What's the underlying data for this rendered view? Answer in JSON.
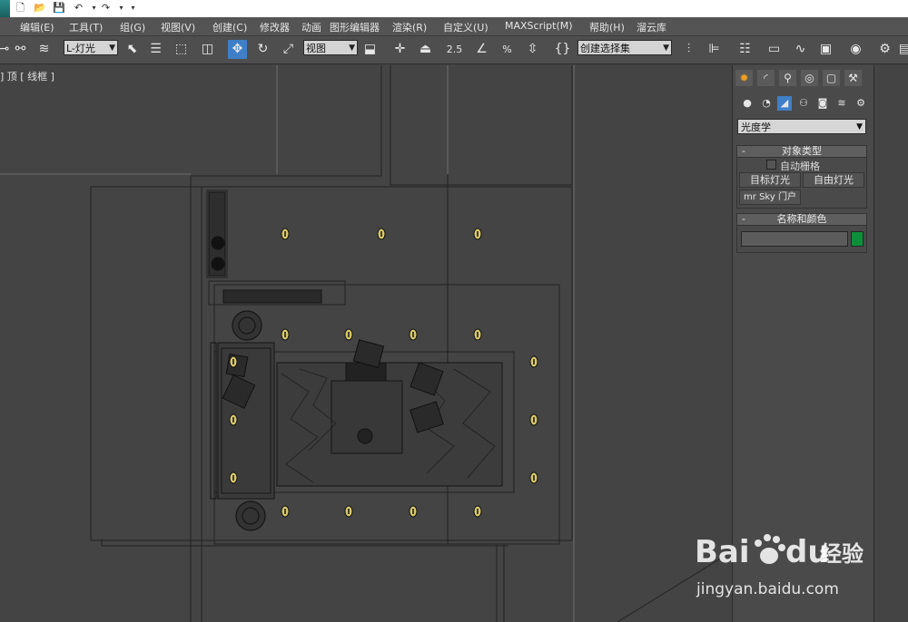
{
  "quick_access": {
    "icons": [
      "new-file-icon",
      "open-file-icon",
      "save-icon",
      "undo-icon",
      "undo-dropdown-icon",
      "redo-icon",
      "redo-dropdown-icon",
      "customize-dropdown-icon"
    ]
  },
  "menu": {
    "items": [
      "编辑(E)",
      "工具(T)",
      "组(G)",
      "视图(V)",
      "创建(C)",
      "修改器",
      "动画",
      "图形编辑器",
      "渲染(R)",
      "自定义(U)",
      "MAXScript(M)",
      "帮助(H)",
      "溜云库"
    ]
  },
  "toolbar": {
    "selection_filter": "L-灯光",
    "reference_coord": "视图",
    "angle_snap_label": "2.5",
    "percent_snap_label": "%",
    "named_selection": "创建选择集",
    "selection_filter_placeholder": "L-灯光"
  },
  "viewport": {
    "label_left": "]",
    "label_view": "顶",
    "label_bracket_mid": "[",
    "label_shading": "线框",
    "label_end": "]"
  },
  "panel": {
    "category": "光度学",
    "object_type": {
      "title": "对象类型",
      "autogrid_label": "自动栅格",
      "autogrid_checked": false,
      "buttons": [
        "目标灯光",
        "自由灯光",
        "mr Sky 门户"
      ]
    },
    "name_color": {
      "title": "名称和颜色",
      "name_value": "",
      "color": "#0d8f3a"
    },
    "collapse_symbol": "-"
  },
  "watermark": {
    "brand_left": "Bai",
    "brand_right": "du",
    "brand_cn": "经验",
    "url": "jingyan.baidu.com"
  },
  "colors": {
    "viewport_bg": "#444444",
    "wire": "#1a1a1a",
    "light_marker": "#d9c96a",
    "active_tool": "#3f7fc8",
    "grid_line": "#6e6e6e"
  }
}
